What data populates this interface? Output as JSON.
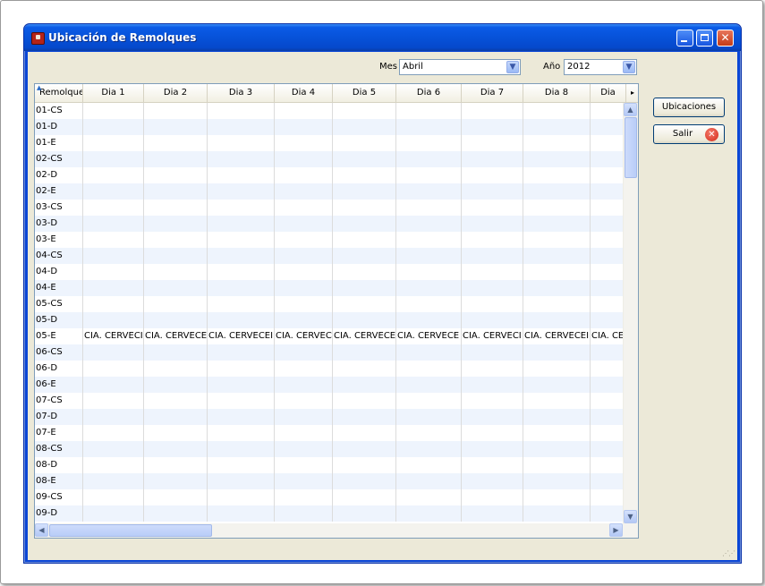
{
  "window": {
    "title": "Ubicación de Remolques",
    "minimize": "",
    "maximize": "",
    "close": "✕"
  },
  "filters": {
    "mes_label": "Mes",
    "mes_value": "Abril",
    "anio_label": "Año",
    "anio_value": "2012"
  },
  "buttons": {
    "ubicaciones": "Ubicaciones",
    "salir": "Salir"
  },
  "grid": {
    "columns": [
      "Remolque",
      "Dia 1",
      "Dia 2",
      "Dia 3",
      "Dia 4",
      "Dia 5",
      "Dia 6",
      "Dia 7",
      "Dia 8",
      "Dia"
    ],
    "rows": [
      {
        "remolque": "01-CS",
        "days": [
          "",
          "",
          "",
          "",
          "",
          "",
          "",
          "",
          ""
        ]
      },
      {
        "remolque": "01-D",
        "days": [
          "",
          "",
          "",
          "",
          "",
          "",
          "",
          "",
          ""
        ]
      },
      {
        "remolque": "01-E",
        "days": [
          "",
          "",
          "",
          "",
          "",
          "",
          "",
          "",
          ""
        ]
      },
      {
        "remolque": "02-CS",
        "days": [
          "",
          "",
          "",
          "",
          "",
          "",
          "",
          "",
          ""
        ]
      },
      {
        "remolque": "02-D",
        "days": [
          "",
          "",
          "",
          "",
          "",
          "",
          "",
          "",
          ""
        ]
      },
      {
        "remolque": "02-E",
        "days": [
          "",
          "",
          "",
          "",
          "",
          "",
          "",
          "",
          ""
        ]
      },
      {
        "remolque": "03-CS",
        "days": [
          "",
          "",
          "",
          "",
          "",
          "",
          "",
          "",
          ""
        ]
      },
      {
        "remolque": "03-D",
        "days": [
          "",
          "",
          "",
          "",
          "",
          "",
          "",
          "",
          ""
        ]
      },
      {
        "remolque": "03-E",
        "days": [
          "",
          "",
          "",
          "",
          "",
          "",
          "",
          "",
          ""
        ]
      },
      {
        "remolque": "04-CS",
        "days": [
          "",
          "",
          "",
          "",
          "",
          "",
          "",
          "",
          ""
        ]
      },
      {
        "remolque": "04-D",
        "days": [
          "",
          "",
          "",
          "",
          "",
          "",
          "",
          "",
          ""
        ]
      },
      {
        "remolque": "04-E",
        "days": [
          "",
          "",
          "",
          "",
          "",
          "",
          "",
          "",
          ""
        ]
      },
      {
        "remolque": "05-CS",
        "days": [
          "",
          "",
          "",
          "",
          "",
          "",
          "",
          "",
          ""
        ]
      },
      {
        "remolque": "05-D",
        "days": [
          "",
          "",
          "",
          "",
          "",
          "",
          "",
          "",
          ""
        ]
      },
      {
        "remolque": "05-E",
        "days": [
          "CIA. CERVECI",
          "CIA. CERVECE",
          "CIA. CERVECEI",
          "CIA. CERVEC",
          "CIA. CERVECE",
          "CIA. CERVECE",
          "CIA. CERVECI",
          "CIA. CERVECEI",
          "CIA. CE"
        ]
      },
      {
        "remolque": "06-CS",
        "days": [
          "",
          "",
          "",
          "",
          "",
          "",
          "",
          "",
          ""
        ]
      },
      {
        "remolque": "06-D",
        "days": [
          "",
          "",
          "",
          "",
          "",
          "",
          "",
          "",
          ""
        ]
      },
      {
        "remolque": "06-E",
        "days": [
          "",
          "",
          "",
          "",
          "",
          "",
          "",
          "",
          ""
        ]
      },
      {
        "remolque": "07-CS",
        "days": [
          "",
          "",
          "",
          "",
          "",
          "",
          "",
          "",
          ""
        ]
      },
      {
        "remolque": "07-D",
        "days": [
          "",
          "",
          "",
          "",
          "",
          "",
          "",
          "",
          ""
        ]
      },
      {
        "remolque": "07-E",
        "days": [
          "",
          "",
          "",
          "",
          "",
          "",
          "",
          "",
          ""
        ]
      },
      {
        "remolque": "08-CS",
        "days": [
          "",
          "",
          "",
          "",
          "",
          "",
          "",
          "",
          ""
        ]
      },
      {
        "remolque": "08-D",
        "days": [
          "",
          "",
          "",
          "",
          "",
          "",
          "",
          "",
          ""
        ]
      },
      {
        "remolque": "08-E",
        "days": [
          "",
          "",
          "",
          "",
          "",
          "",
          "",
          "",
          ""
        ]
      },
      {
        "remolque": "09-CS",
        "days": [
          "",
          "",
          "",
          "",
          "",
          "",
          "",
          "",
          ""
        ]
      },
      {
        "remolque": "09-D",
        "days": [
          "",
          "",
          "",
          "",
          "",
          "",
          "",
          "",
          ""
        ]
      }
    ]
  },
  "icons": {
    "app": "trailer-app-icon",
    "close_button": "close-x-icon",
    "sort": "sort-ascending-icon"
  },
  "colors": {
    "titlebar": "#0752d9",
    "client_bg": "#ece9d8",
    "row_alt": "#eef4fd",
    "close_red": "#d42a1a"
  }
}
